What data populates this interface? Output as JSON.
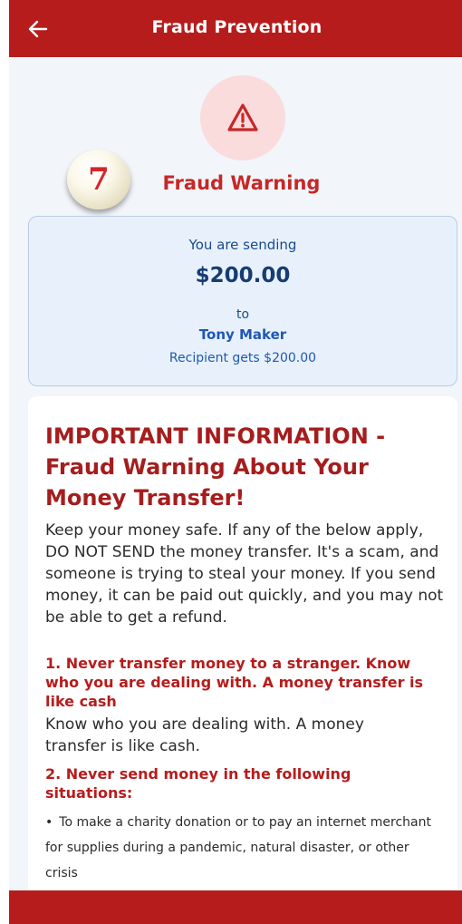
{
  "header": {
    "title": "Fraud Prevention",
    "back_icon": "arrow-left-icon",
    "color": "#b71c1c"
  },
  "warning": {
    "icon": "warning-triangle-icon",
    "step_badge": "7",
    "title": "Fraud Warning"
  },
  "transfer": {
    "sending_label": "You are sending",
    "amount": "$200.00",
    "to_label": "to",
    "recipient_name": "Tony Maker",
    "recipient_gets": "Recipient gets $200.00"
  },
  "info": {
    "heading": "IMPORTANT INFORMATION - Fraud Warning About Your Money Transfer!",
    "intro": "Keep your money safe. If any of the below apply, DO NOT SEND the money transfer. It's a scam, and someone is trying to steal your money. If you send money, it can be paid out quickly, and you may not be able to get a refund.",
    "rules": [
      {
        "title": "1. Never transfer money to a stranger. Know who you are dealing with. A money transfer is like cash",
        "body": "Know who you are dealing with. A money transfer is like cash."
      },
      {
        "title": "2. Never send money in the following situations:",
        "bullets": [
          "To make a charity donation or to pay an internet merchant for supplies during a pandemic, natural disaster, or other crisis"
        ]
      }
    ]
  }
}
